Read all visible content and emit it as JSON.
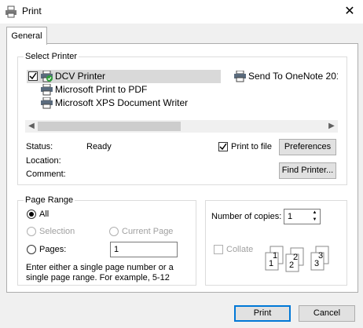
{
  "window": {
    "title": "Print"
  },
  "tabs": [
    {
      "label": "General"
    }
  ],
  "select_printer": {
    "title": "Select Printer",
    "printers": [
      {
        "name": "DCV Printer",
        "selected": true,
        "default": true
      },
      {
        "name": "Microsoft Print to PDF"
      },
      {
        "name": "Microsoft XPS Document Writer"
      },
      {
        "name": "Send To OneNote 201"
      }
    ]
  },
  "status": {
    "status_label": "Status:",
    "status_value": "Ready",
    "location_label": "Location:",
    "location_value": "",
    "comment_label": "Comment:",
    "comment_value": ""
  },
  "print_to_file": {
    "label": "Print to file",
    "checked": true
  },
  "buttons": {
    "preferences": "Preferences",
    "find_printer": "Find Printer...",
    "print": "Print",
    "cancel": "Cancel"
  },
  "page_range": {
    "title": "Page Range",
    "all": "All",
    "selection": "Selection",
    "current_page": "Current Page",
    "pages": "Pages:",
    "pages_value": "1",
    "help": "Enter either a single page number or a single page range.  For example, 5-12"
  },
  "copies": {
    "label": "Number of copies:",
    "value": "1",
    "collate": "Collate",
    "collate_checked": false
  },
  "collate_illustration": [
    "1",
    "1",
    "2",
    "2",
    "3",
    "3"
  ]
}
